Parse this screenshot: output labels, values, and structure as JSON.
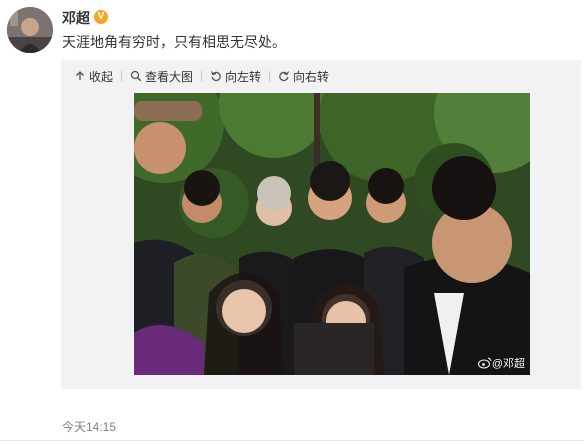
{
  "post": {
    "username": "邓超",
    "verified_badge": "V",
    "text": "天涯地角有穷时，只有相思无尽处。",
    "timestamp": "今天14:15"
  },
  "toolbar": {
    "collapse_label": "收起",
    "view_large_label": "查看大图",
    "rotate_left_label": "向左转",
    "rotate_right_label": "向右转"
  },
  "photo": {
    "watermark": "@邓超"
  },
  "colors": {
    "badge": "#f5a623",
    "timestamp": "#808080",
    "media_bg": "#f2f2f5"
  },
  "icons": {
    "collapse": "upload-arrow-icon",
    "view_large": "magnifier-icon",
    "rotate_left": "rotate-left-icon",
    "rotate_right": "rotate-right-icon",
    "weibo": "weibo-icon"
  }
}
